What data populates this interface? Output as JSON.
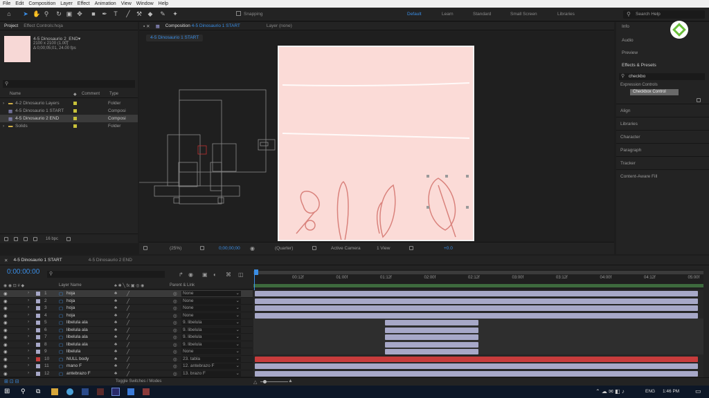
{
  "menu": [
    "File",
    "Edit",
    "Composition",
    "Layer",
    "Effect",
    "Animation",
    "View",
    "Window",
    "Help"
  ],
  "toolbar": {
    "snapping": "Snapping",
    "workspaces": [
      "Default",
      "Learn",
      "Standard",
      "Small Screen",
      "Libraries"
    ],
    "search": "Search Help"
  },
  "project": {
    "tab1": "Project",
    "tab2": "Effect Controls:hoja",
    "item_name": "4-5 Dinosaurio 2_END▾",
    "item_size": "2100 x 2100 (1.00)",
    "item_dur": "Δ 0;00;05;01, 24.00 fps",
    "cols": [
      "Name",
      "Comment",
      "Type"
    ],
    "items": [
      {
        "name": "4-2 Dinosaurio Layers",
        "type": "Folder"
      },
      {
        "name": "4-5 Dinosaurio 1 START",
        "type": "Composi"
      },
      {
        "name": "4-5 Dinosaurio 2 END",
        "type": "Composi"
      },
      {
        "name": "Solids",
        "type": "Folder"
      }
    ],
    "bpc": "16 bpc"
  },
  "comp": {
    "tab": "Composition",
    "tab_link": "4-5 Dinosaurio 1 START",
    "layer_tab": "Layer (none)",
    "subtab": "4-5 Dinosaurio 1 START",
    "footer": {
      "zoom": "(25%)",
      "time": "0;00;00;00",
      "res": "(Quarter)",
      "camera": "Active Camera",
      "views": "1 View",
      "offset": "+0.0"
    }
  },
  "right": {
    "info": "Info",
    "audio": "Audio",
    "preview": "Preview",
    "effects": "Effects & Presets",
    "search_value": "checkbo",
    "category": "Expression Controls",
    "effect": "Checkbox Control",
    "panels": [
      "Align",
      "Libraries",
      "Character",
      "Paragraph",
      "Tracker",
      "Content-Aware Fill"
    ]
  },
  "timeline": {
    "tab1": "4-5 Dinosaurio 1 START",
    "tab2": "4-5 Dinosaurio 2 END",
    "timecode": "0:00:00:00",
    "col_layer": "Layer Name",
    "col_parent": "Parent & Link",
    "ticks": [
      "00:12f",
      "01:00f",
      "01:12f",
      "02:00f",
      "02:12f",
      "03:00f",
      "03:12f",
      "04:00f",
      "04:12f",
      "05:00f"
    ],
    "toggle": "Toggle Switches / Modes",
    "layers": [
      {
        "num": "1",
        "name": "hoja",
        "parent": "None",
        "color": "#a7a8c8"
      },
      {
        "num": "2",
        "name": "hoja",
        "parent": "None",
        "color": "#a7a8c8"
      },
      {
        "num": "3",
        "name": "hoja",
        "parent": "None",
        "color": "#a7a8c8"
      },
      {
        "num": "4",
        "name": "hoja",
        "parent": "None",
        "color": "#a7a8c8"
      },
      {
        "num": "5",
        "name": "libelula ala",
        "parent": "9. libelula",
        "color": "#a7a8c8"
      },
      {
        "num": "6",
        "name": "libelula ala",
        "parent": "9. libelula",
        "color": "#a7a8c8"
      },
      {
        "num": "7",
        "name": "libelula ala",
        "parent": "9. libelula",
        "color": "#a7a8c8"
      },
      {
        "num": "8",
        "name": "libelula ala",
        "parent": "9. libelula",
        "color": "#a7a8c8"
      },
      {
        "num": "9",
        "name": "libelula",
        "parent": "None",
        "color": "#a7a8c8"
      },
      {
        "num": "10",
        "name": "NULL body",
        "parent": "23. tabla",
        "color": "#c83c3c"
      },
      {
        "num": "11",
        "name": "mano F",
        "parent": "12. antebrazo F",
        "color": "#a7a8c8"
      },
      {
        "num": "12",
        "name": "antebrazo F",
        "parent": "13. brazo F",
        "color": "#a7a8c8"
      }
    ]
  },
  "taskbar": {
    "lang": "ENG",
    "time": "1:46 PM"
  }
}
